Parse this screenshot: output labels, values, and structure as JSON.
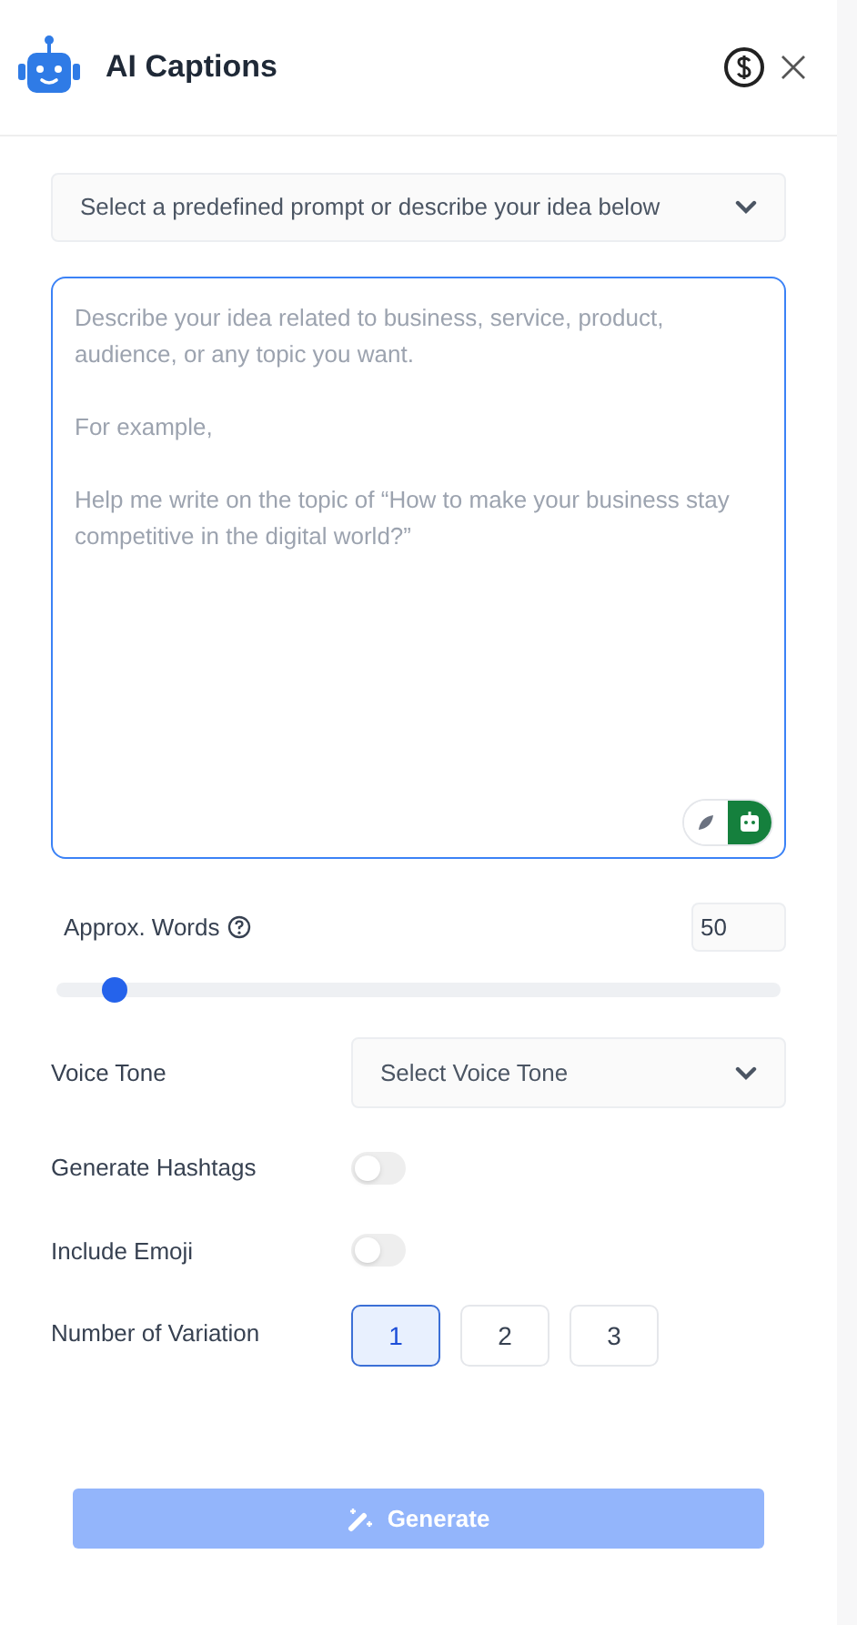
{
  "header": {
    "title": "AI Captions"
  },
  "prompt_select": {
    "placeholder": "Select a predefined prompt or describe your idea below"
  },
  "idea": {
    "placeholder": "Describe your idea related to business, service, product, audience, or any topic you want.\n\nFor example,\n\nHelp me write on the topic of “How to make your business stay competitive in the digital world?”"
  },
  "modes": [
    {
      "selected": false
    },
    {
      "selected": true
    }
  ],
  "words": {
    "label": "Approx. Words",
    "value": "50",
    "level": 0.08
  },
  "voice_tone": {
    "label": "Voice Tone",
    "placeholder": "Select Voice Tone"
  },
  "toggles": [
    {
      "label": "Generate Hashtags",
      "on": false
    },
    {
      "label": "Include Emoji",
      "on": false
    }
  ],
  "variation": {
    "label": "Number of Variation",
    "options": [
      {
        "label": "1",
        "selected": true
      },
      {
        "label": "2",
        "selected": false
      },
      {
        "label": "3",
        "selected": false
      }
    ]
  },
  "generate": {
    "label": "Generate",
    "disabled": true
  }
}
